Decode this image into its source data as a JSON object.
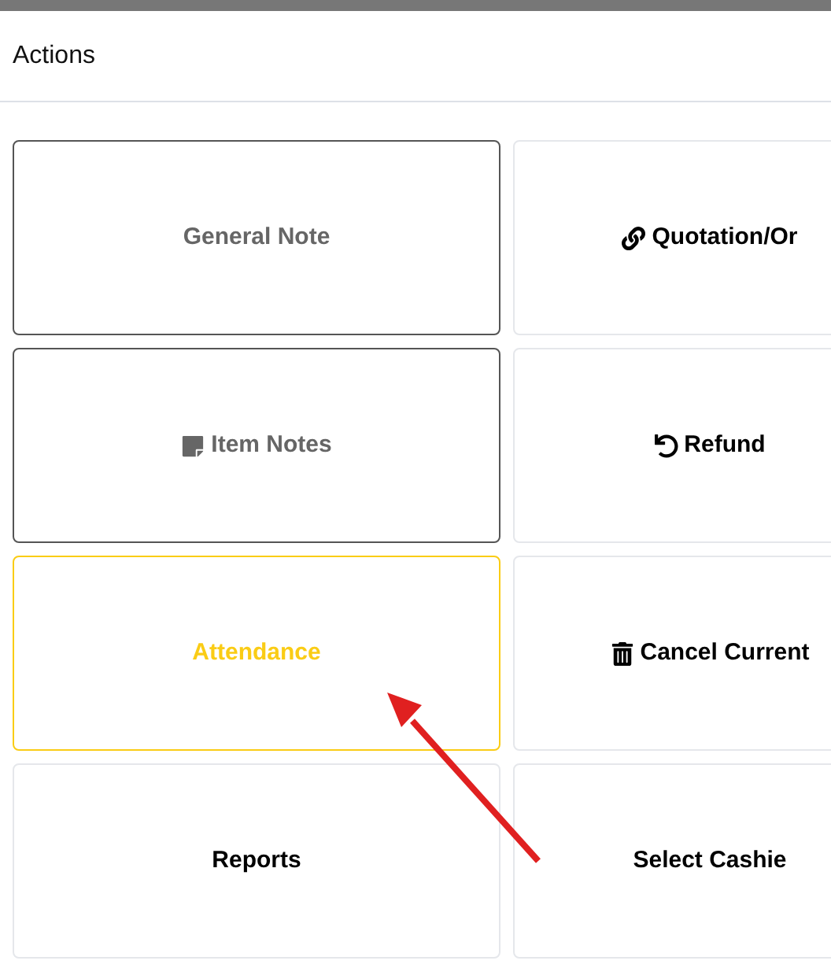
{
  "header": {
    "title": "Actions"
  },
  "actions": [
    {
      "label": "General Note",
      "kind": "plain",
      "disabled": true,
      "selected": false
    },
    {
      "label": "Quotation/Or",
      "kind": "link",
      "disabled": false,
      "selected": false
    },
    {
      "label": "Item Notes",
      "kind": "note",
      "disabled": true,
      "selected": false
    },
    {
      "label": "Refund",
      "kind": "undo",
      "disabled": false,
      "selected": false
    },
    {
      "label": "Attendance",
      "kind": "plain",
      "disabled": false,
      "selected": true
    },
    {
      "label": "Cancel Current",
      "kind": "trash",
      "disabled": false,
      "selected": false
    },
    {
      "label": "Reports",
      "kind": "plain",
      "disabled": false,
      "selected": false
    },
    {
      "label": "Select Cashie",
      "kind": "plain",
      "disabled": false,
      "selected": false
    }
  ]
}
